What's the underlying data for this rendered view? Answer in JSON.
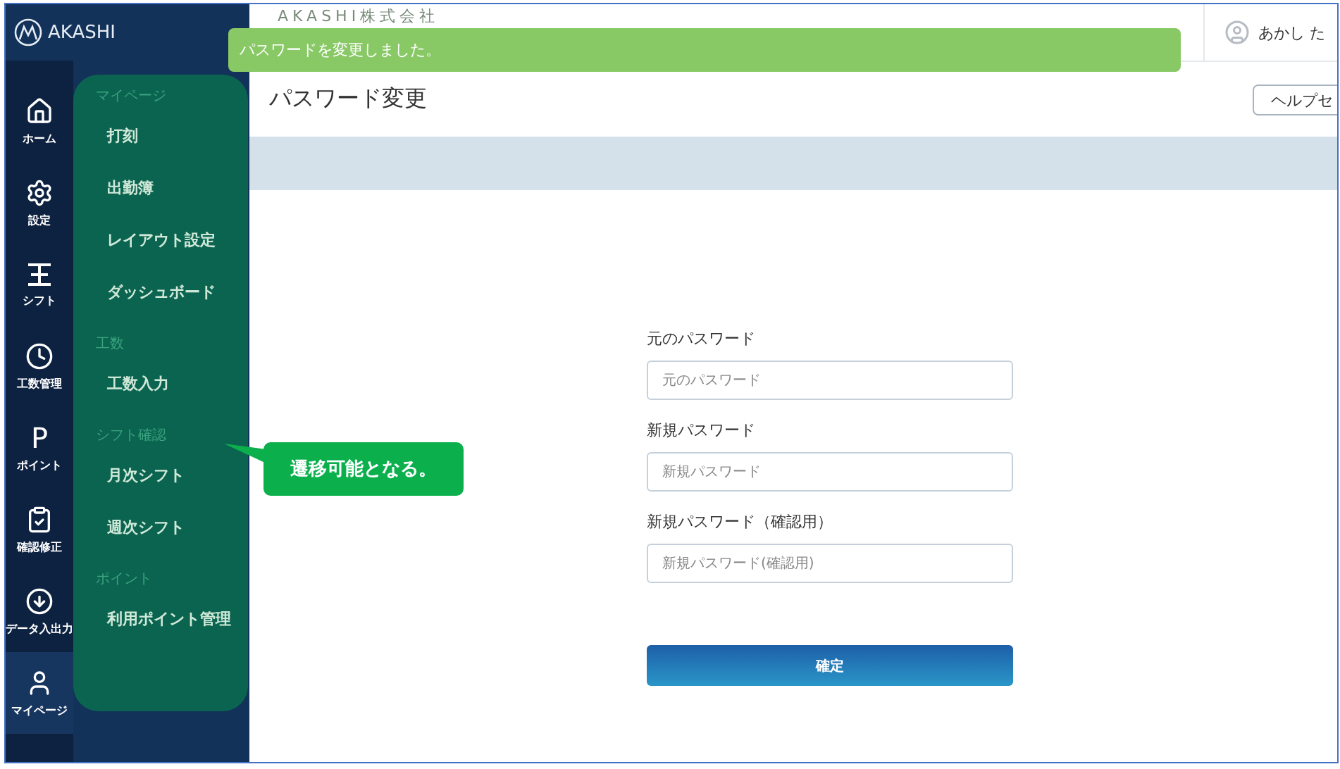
{
  "app": {
    "logo": "AKASHI",
    "company": "AKASHI株式会社",
    "user": "あかし た"
  },
  "toast": {
    "message": "パスワードを変更しました。"
  },
  "nav": [
    {
      "kind": "home",
      "label": "ホーム",
      "selected": false
    },
    {
      "kind": "gear",
      "label": "設定",
      "selected": false
    },
    {
      "kind": "shift",
      "label": "シフト",
      "selected": false
    },
    {
      "kind": "clock",
      "label": "工数管理",
      "selected": false
    },
    {
      "kind": "letter",
      "glyph": "P",
      "label": "ポイント",
      "selected": false
    },
    {
      "kind": "clipboard",
      "label": "確認修正",
      "selected": false
    },
    {
      "kind": "download",
      "label": "データ入出力",
      "selected": false
    },
    {
      "kind": "user",
      "label": "マイページ",
      "selected": true
    }
  ],
  "menu": [
    {
      "heading": "マイページ",
      "items": [
        "打刻",
        "出勤簿",
        "レイアウト設定",
        "ダッシュボード"
      ]
    },
    {
      "heading": "工数",
      "items": [
        "工数入力"
      ]
    },
    {
      "heading": "シフト確認",
      "items": [
        "月次シフト",
        "週次シフト"
      ]
    },
    {
      "heading": "ポイント",
      "items": [
        "利用ポイント管理"
      ]
    }
  ],
  "page": {
    "title": "パスワード変更",
    "help_button": "ヘルプセ"
  },
  "form": {
    "fields": [
      {
        "label": "元のパスワード",
        "placeholder": "元のパスワード"
      },
      {
        "label": "新規パスワード",
        "placeholder": "新規パスワード"
      },
      {
        "label": "新規パスワード（確認用）",
        "placeholder": "新規パスワード(確認用)"
      }
    ],
    "submit": "確定"
  },
  "callout": {
    "text": "遷移可能となる。"
  }
}
